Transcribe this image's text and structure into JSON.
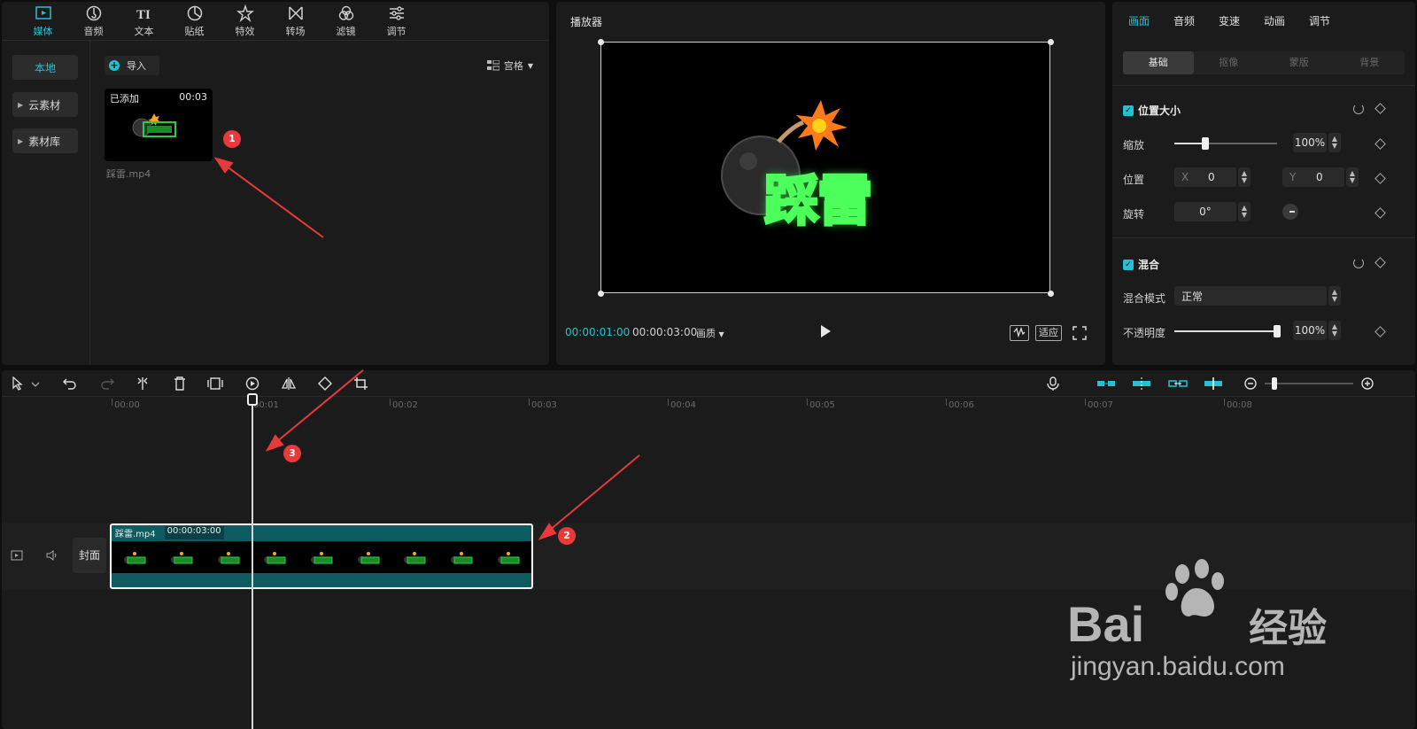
{
  "media_panel": {
    "tabs": [
      {
        "label": "媒体",
        "icon": "media-icon",
        "active": true
      },
      {
        "label": "音频",
        "icon": "audio-icon"
      },
      {
        "label": "文本",
        "icon": "text-icon"
      },
      {
        "label": "贴纸",
        "icon": "sticker-icon"
      },
      {
        "label": "特效",
        "icon": "effects-icon"
      },
      {
        "label": "转场",
        "icon": "transition-icon"
      },
      {
        "label": "滤镜",
        "icon": "filter-icon"
      },
      {
        "label": "调节",
        "icon": "adjust-icon"
      }
    ],
    "sidebar": [
      "本地",
      "云素材",
      "素材库"
    ],
    "import_label": "导入",
    "view_label": "宫格",
    "asset": {
      "badge": "已添加",
      "duration": "00:03",
      "name": "踩雷.mp4"
    }
  },
  "player": {
    "title": "播放器",
    "current_time": "00:00:01:00",
    "total_time": "00:00:03:00",
    "quality_label": "画质",
    "fit_label": "适应",
    "preview_text": "踩雷"
  },
  "properties": {
    "tabs": [
      "画面",
      "音频",
      "变速",
      "动画",
      "调节"
    ],
    "subtabs": [
      "基础",
      "抠像",
      "蒙版",
      "背景"
    ],
    "section_position": "位置大小",
    "scale_label": "缩放",
    "scale_value": "100%",
    "scale_level": 0.3,
    "position_label": "位置",
    "x_label": "X",
    "x_value": "0",
    "y_label": "Y",
    "y_value": "0",
    "rotation_label": "旋转",
    "rotation_value": "0°",
    "section_blend": "混合",
    "blend_mode_label": "混合模式",
    "blend_mode_value": "正常",
    "opacity_label": "不透明度",
    "opacity_value": "100%",
    "opacity_level": 1.0
  },
  "timeline": {
    "ruler": [
      "00:00",
      "00:01",
      "00:02",
      "00:03",
      "00:04",
      "00:05",
      "00:06",
      "00:07",
      "00:08"
    ],
    "clip": {
      "name": "踩雷.mp4",
      "duration": "00:00:03:00"
    },
    "cover_label": "封面"
  },
  "annotations": [
    "1",
    "2",
    "3"
  ],
  "watermark": {
    "brand": "Bai",
    "brand2": "du",
    "suffix": "经验",
    "url": "jingyan.baidu.com"
  },
  "colors": {
    "accent": "#22c2d4",
    "clip": "#0e5b62",
    "marker": "#e83a3a",
    "neon": "#2ecc40"
  }
}
